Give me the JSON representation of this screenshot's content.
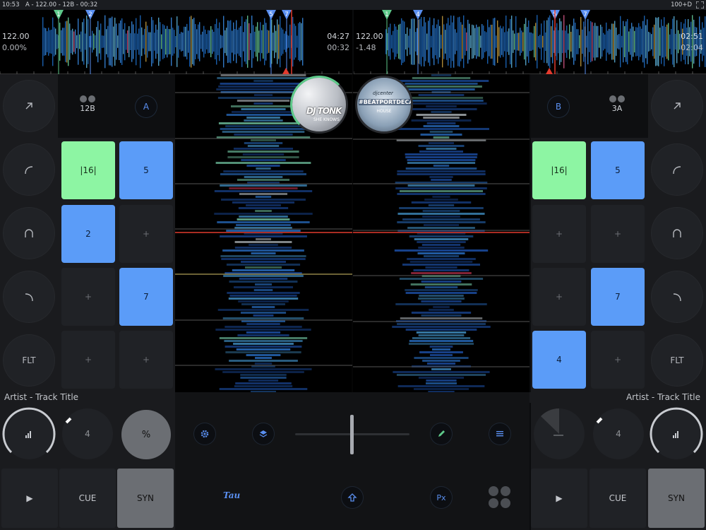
{
  "status": {
    "time": "10:53",
    "info": "A - 122.00 - 12B - 00:32",
    "battery": "100+D"
  },
  "deck_a": {
    "bpm": "122.00",
    "pitch": "0.00%",
    "time_total": "04:27",
    "time_elapsed": "00:32",
    "key_left": "12B",
    "deck_label": "A",
    "cue_flags": [
      "1",
      "2",
      "5",
      "7"
    ],
    "pads": [
      "|16|",
      "5",
      "2",
      "+",
      "+",
      "7",
      "+",
      "+"
    ],
    "title": "Artist - Track Title",
    "loop_size": "4",
    "pct_label": "%",
    "play_label": "▶",
    "cue_label": "CUE",
    "sync_label": "SYN",
    "cover_artist": "DJ TONK",
    "cover_sub": "SHE KNOWS"
  },
  "deck_b": {
    "bpm": "122.00",
    "pitch": "-1.48",
    "time_total": "02:51",
    "time_elapsed": "02:04",
    "key_right": "3A",
    "deck_label": "B",
    "cue_flags": [
      "1",
      "4",
      "5",
      "7"
    ],
    "pads": [
      "|16|",
      "5",
      "+",
      "+",
      "+",
      "7",
      "4",
      "+"
    ],
    "title": "Artist - Track Title",
    "loop_size": "4",
    "play_label": "▶",
    "cue_label": "CUE",
    "sync_label": "SYN",
    "cover_line1": "djcenter",
    "cover_line2": "#BEATPORTDECADE",
    "cover_line3": "HOUSE"
  },
  "fx_left": [
    "arrow-icon",
    "hpf-icon",
    "bpf-icon",
    "lpf-icon",
    "FLT"
  ],
  "fx_right": [
    "arrow-icon",
    "hpf-icon",
    "bpf-icon",
    "lpf-icon",
    "FLT"
  ],
  "center": {
    "brand_logo": "Tau",
    "px_label": "Px",
    "icons": [
      "gear-icon",
      "layers-icon",
      "pencil-icon",
      "list-icon",
      "shift-icon",
      "grid-icon"
    ]
  },
  "colors": {
    "accent_blue": "#5a8ff0",
    "pad_green": "#8df5a3",
    "pad_blue": "#5b9cf8",
    "sync_gray": "#6b6e73",
    "marker_red": "#e23b2e"
  }
}
